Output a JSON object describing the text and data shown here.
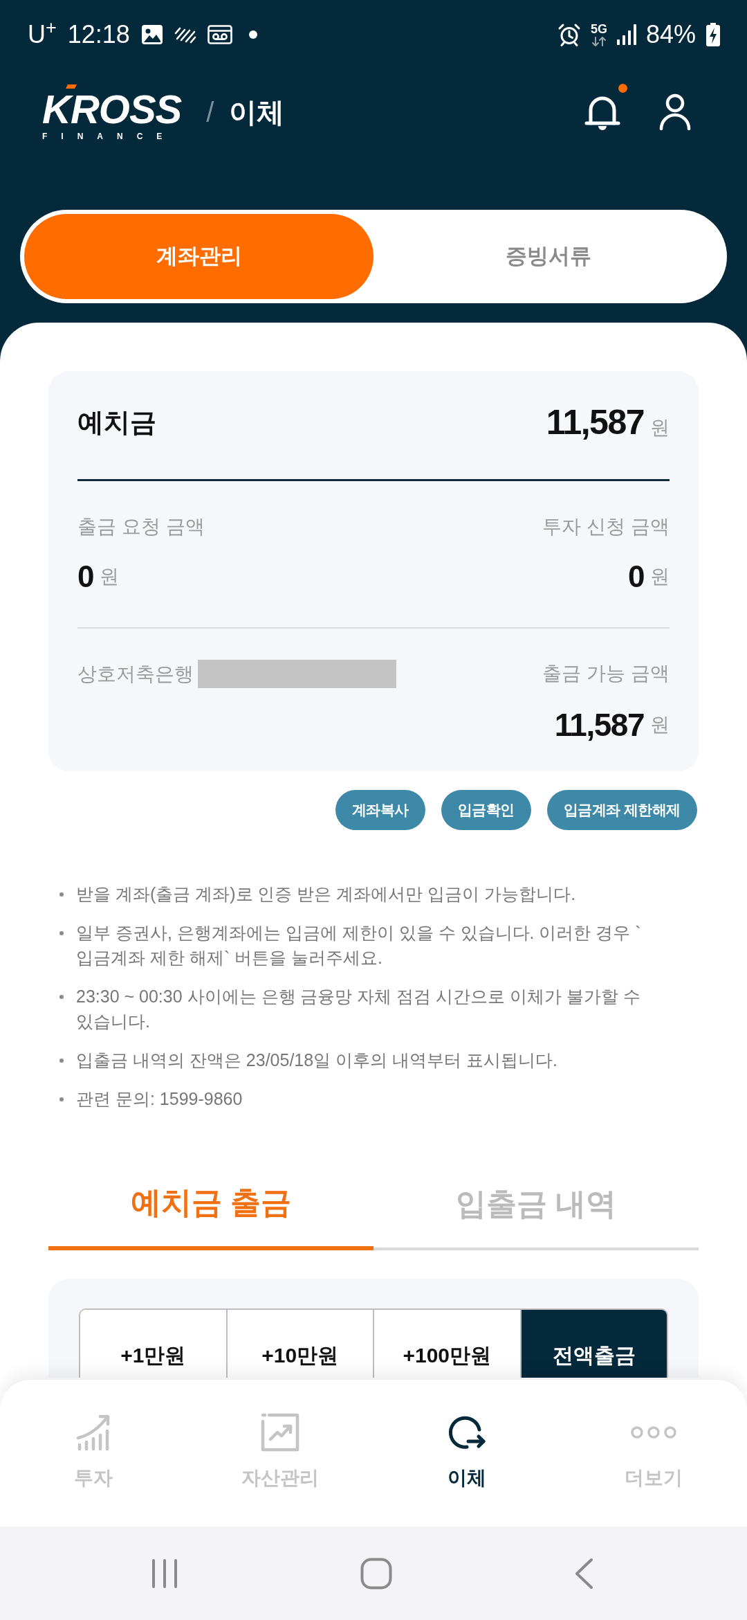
{
  "status_bar": {
    "carrier": "U$^{+}$",
    "time": "12:18",
    "network": "5G",
    "battery": "84%"
  },
  "header": {
    "logo": {
      "wordmark": "KROSS",
      "tagline": "FINANCE"
    },
    "separator": "/",
    "title": "이체",
    "has_new_notification": true
  },
  "segments": [
    {
      "label": "계좌관리",
      "selected": true
    },
    {
      "label": "증빙서류",
      "selected": false
    }
  ],
  "balance_card": {
    "deposit": {
      "label": "예치금",
      "amount": "11,587",
      "unit": "원"
    },
    "withdrawal_request": {
      "label": "출금 요청 금액",
      "amount": "0",
      "unit": "원"
    },
    "investment_request": {
      "label": "투자 신청 금액",
      "amount": "0",
      "unit": "원"
    },
    "bank": {
      "name": "상호저축은행",
      "account_hidden": true
    },
    "withdrawable": {
      "label": "출금 가능 금액",
      "amount": "11,587",
      "unit": "원"
    }
  },
  "action_buttons": [
    "계좌복사",
    "입금확인",
    "입금계좌 제한해제"
  ],
  "notices": [
    "받을 계좌(출금 계좌)로 인증 받은 계좌에서만 입금이 가능합니다.",
    "일부 증권사, 은행계좌에는 입금에 제한이 있을 수 있습니다. 이러한 경우 `입금계좌 제한 해제` 버튼을 눌러주세요.",
    "23:30 ~ 00:30 사이에는 은행 금융망 자체 점검 시간으로 이체가 불가할 수 있습니다.",
    "입출금 내역의 잔액은 23/05/18일 이후의 내역부터 표시됩니다.",
    "관련 문의: 1599-9860"
  ],
  "tabs": [
    {
      "label": "예치금 출금",
      "selected": true
    },
    {
      "label": "입출금 내역",
      "selected": false
    }
  ],
  "quick_amounts": [
    {
      "label": "+1만원",
      "kind": "add"
    },
    {
      "label": "+10만원",
      "kind": "add"
    },
    {
      "label": "+100만원",
      "kind": "add"
    },
    {
      "label": "전액출금",
      "kind": "all"
    }
  ],
  "bottom_nav": [
    {
      "label": "투자",
      "selected": false
    },
    {
      "label": "자산관리",
      "selected": false
    },
    {
      "label": "이체",
      "selected": true
    },
    {
      "label": "더보기",
      "selected": false
    }
  ]
}
